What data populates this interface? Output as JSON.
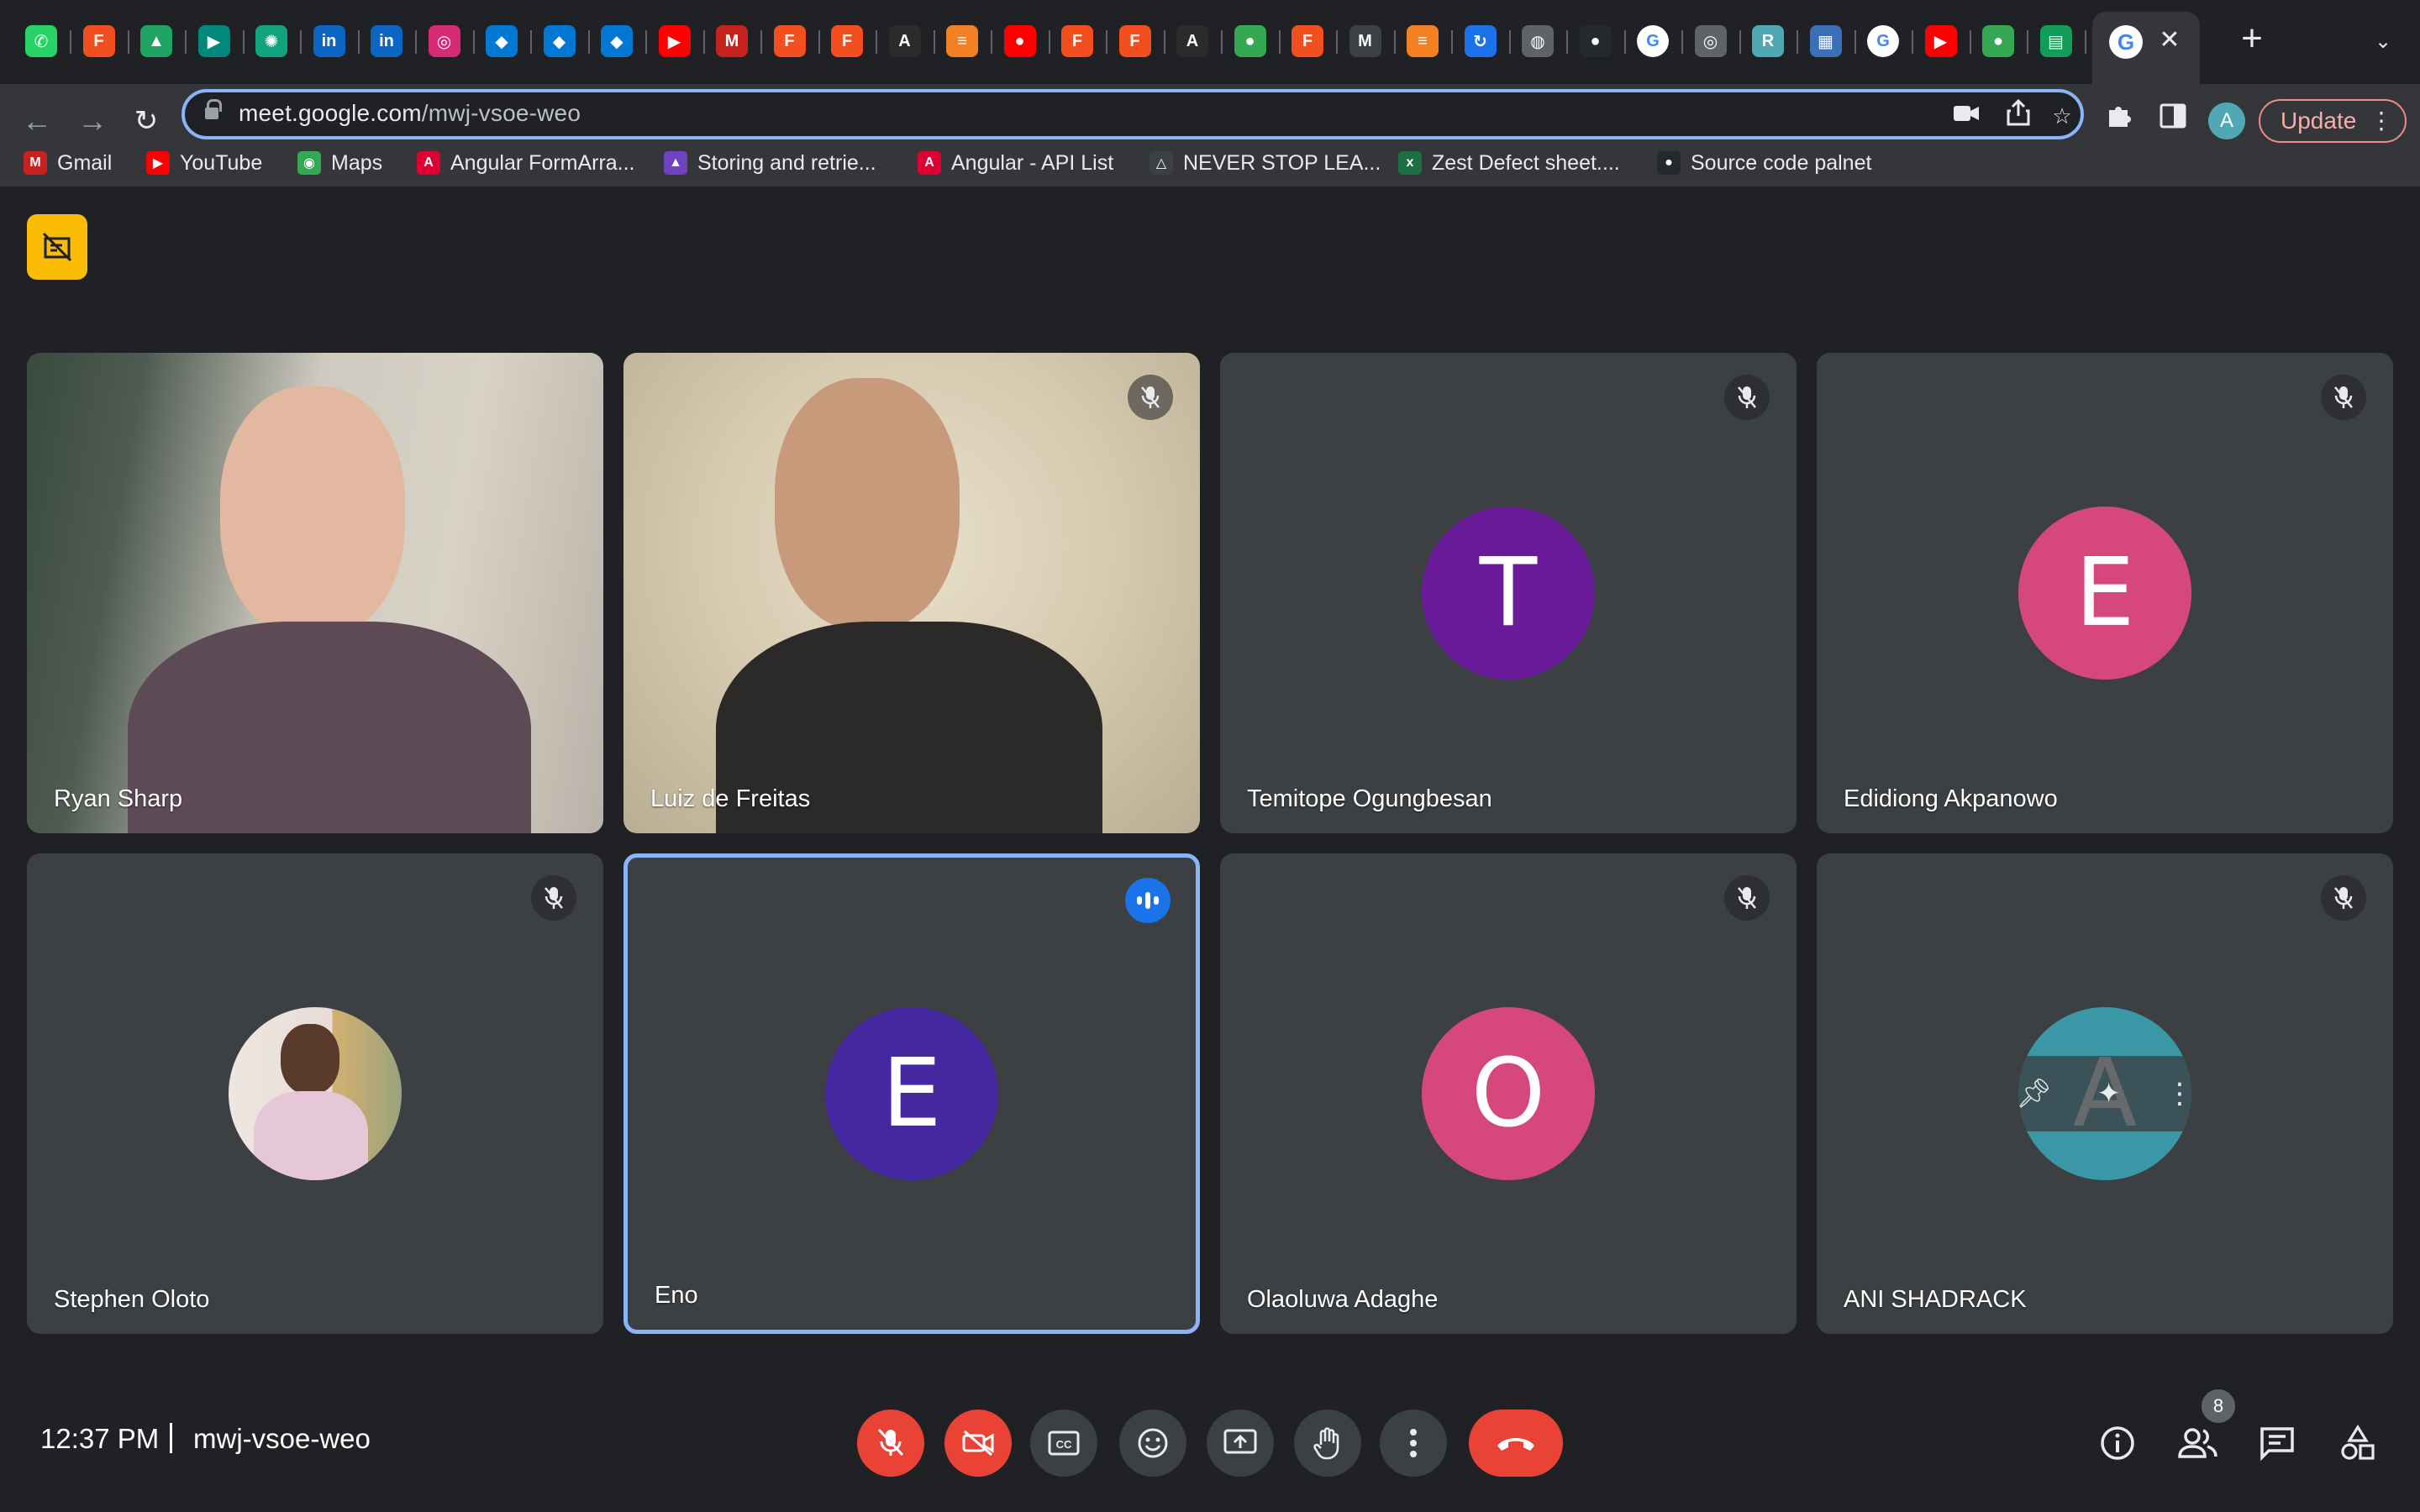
{
  "browser": {
    "url_host": "meet.google.com",
    "url_path": "/mwj-vsoe-weo",
    "update_label": "Update",
    "profile_initial": "A",
    "tab_favicons": [
      {
        "icon": "whatsapp-icon",
        "color": "#25d366",
        "glyph": "✆"
      },
      {
        "icon": "figma-icon",
        "color": "#f24e1e",
        "glyph": "F"
      },
      {
        "icon": "drive-icon",
        "color": "#1fa463",
        "glyph": "▲"
      },
      {
        "icon": "meet-icon",
        "color": "#00897b",
        "glyph": "▶"
      },
      {
        "icon": "chatgpt-icon",
        "color": "#10a37f",
        "glyph": "✺"
      },
      {
        "icon": "linkedin-icon",
        "color": "#0a66c2",
        "glyph": "in"
      },
      {
        "icon": "linkedin-icon",
        "color": "#0a66c2",
        "glyph": "in"
      },
      {
        "icon": "instagram-icon",
        "color": "#d62976",
        "glyph": "◎"
      },
      {
        "icon": "azure-devops-icon",
        "color": "#0078d4",
        "glyph": "◆"
      },
      {
        "icon": "azure-devops-icon",
        "color": "#0078d4",
        "glyph": "◆"
      },
      {
        "icon": "azure-devops-icon",
        "color": "#0078d4",
        "glyph": "◆"
      },
      {
        "icon": "youtube-icon",
        "color": "#ff0000",
        "glyph": "▶"
      },
      {
        "icon": "gmail-icon",
        "color": "#c5221f",
        "glyph": "M"
      },
      {
        "icon": "figma-icon",
        "color": "#f24e1e",
        "glyph": "F"
      },
      {
        "icon": "figma-icon",
        "color": "#f24e1e",
        "glyph": "F"
      },
      {
        "icon": "angular-icon",
        "color": "#2b2b2b",
        "glyph": "A"
      },
      {
        "icon": "stackoverflow-icon",
        "color": "#f48024",
        "glyph": "≡"
      },
      {
        "icon": "youtube-music-icon",
        "color": "#ff0000",
        "glyph": "●"
      },
      {
        "icon": "figma-icon",
        "color": "#f24e1e",
        "glyph": "F"
      },
      {
        "icon": "figma-icon",
        "color": "#f24e1e",
        "glyph": "F"
      },
      {
        "icon": "angular-icon",
        "color": "#2b2b2b",
        "glyph": "A"
      },
      {
        "icon": "spring-icon",
        "color": "#34a853",
        "glyph": "●"
      },
      {
        "icon": "figma-icon",
        "color": "#f24e1e",
        "glyph": "F"
      },
      {
        "icon": "markdown-icon",
        "color": "#3c4043",
        "glyph": "M"
      },
      {
        "icon": "stackoverflow-icon",
        "color": "#f48024",
        "glyph": "≡"
      },
      {
        "icon": "refresh-blue-icon",
        "color": "#1a73e8",
        "glyph": "↻"
      },
      {
        "icon": "globe-icon",
        "color": "#5f6368",
        "glyph": "◍"
      },
      {
        "icon": "github-icon",
        "color": "#24292e",
        "glyph": "●"
      },
      {
        "icon": "google-icon",
        "color": "#ffffff",
        "glyph": "G"
      },
      {
        "icon": "chrome-icon",
        "color": "#5f6368",
        "glyph": "◎"
      },
      {
        "icon": "r-icon",
        "color": "#4fa8b3",
        "glyph": "R"
      },
      {
        "icon": "map-tile-icon",
        "color": "#3b6fb6",
        "glyph": "▦"
      },
      {
        "icon": "google-icon",
        "color": "#ffffff",
        "glyph": "G"
      },
      {
        "icon": "youtube-icon",
        "color": "#ff0000",
        "glyph": "▶"
      },
      {
        "icon": "spring-icon",
        "color": "#34a853",
        "glyph": "●"
      },
      {
        "icon": "sheets-icon",
        "color": "#0f9d58",
        "glyph": "▤"
      }
    ],
    "active_tab_icon": "google-icon",
    "bookmarks": [
      {
        "label": "Gmail",
        "icon": "gmail-icon",
        "color": "#c5221f",
        "glyph": "M"
      },
      {
        "label": "YouTube",
        "icon": "youtube-icon",
        "color": "#ff0000",
        "glyph": "▶"
      },
      {
        "label": "Maps",
        "icon": "maps-icon",
        "color": "#34a853",
        "glyph": "◉"
      },
      {
        "label": "Angular FormArra...",
        "icon": "angular-icon",
        "color": "#dd0031",
        "glyph": "A"
      },
      {
        "label": "Storing and retrie...",
        "icon": "rocket-icon",
        "color": "#6f42c1",
        "glyph": "▲"
      },
      {
        "label": "Angular - API List",
        "icon": "angular-icon",
        "color": "#dd0031",
        "glyph": "A"
      },
      {
        "label": "NEVER STOP LEA...",
        "icon": "triangle-logo-icon",
        "color": "#3c4043",
        "glyph": "△"
      },
      {
        "label": "Zest Defect sheet....",
        "icon": "excel-icon",
        "color": "#1d6f42",
        "glyph": "x"
      },
      {
        "label": "Source code palnet",
        "icon": "github-icon",
        "color": "#24292e",
        "glyph": "●"
      }
    ]
  },
  "meet": {
    "participants": [
      {
        "name": "Ryan Sharp",
        "kind": "video",
        "muted": false
      },
      {
        "name": "Luiz de Freitas",
        "kind": "video",
        "muted": true
      },
      {
        "name": "Temitope Ogungbesan",
        "kind": "avatar",
        "initial": "T",
        "color": "#6a1b9a",
        "muted": true
      },
      {
        "name": "Edidiong Akpanowo",
        "kind": "avatar",
        "initial": "E",
        "color": "#d6487d",
        "muted": true
      },
      {
        "name": "Stephen Oloto",
        "kind": "photo",
        "muted": true
      },
      {
        "name": "Eno",
        "kind": "avatar",
        "initial": "E",
        "color": "#4527a0",
        "muted": false,
        "speaking": true
      },
      {
        "name": "Olaoluwa Adaghe",
        "kind": "avatar",
        "initial": "O",
        "color": "#d6487d",
        "muted": true
      },
      {
        "name": "ANI SHADRACK",
        "kind": "avatar",
        "initial": "A",
        "color": "#3a97a5",
        "muted": true,
        "hovered": true
      }
    ],
    "time": "12:37 PM",
    "meeting_code": "mwj-vsoe-weo",
    "people_count": "8",
    "accent": "#8ab4f8",
    "danger": "#ea4335"
  }
}
